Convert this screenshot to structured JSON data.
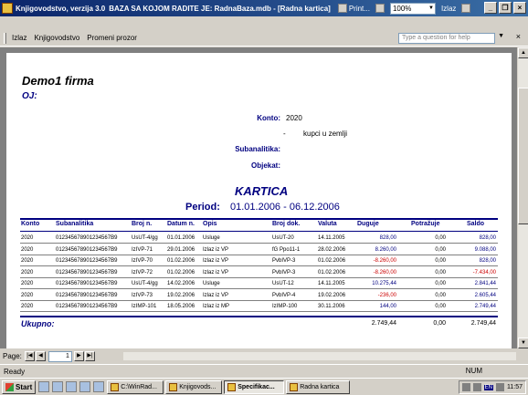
{
  "window": {
    "app_title": "Knjigovodstvo, verzija 3.0",
    "db_info": "BAZA SA KOJOM RADITE JE: RadnaBaza.mdb - [Radna kartica]",
    "print_label": "Print...",
    "zoom": "100%",
    "close_label": "Izlaz"
  },
  "menu": {
    "items": [
      "Izlaz",
      "Knjigovodstvo",
      "Promeni prozor"
    ],
    "question_placeholder": "Type a question for help"
  },
  "report": {
    "company": "Demo1 firma",
    "oj_label": "OJ:",
    "konto_label": "Konto:",
    "konto_value": "2020",
    "dash": "-",
    "konto_name": "kupci u zemlji",
    "subanalitika_label": "Subanalitika:",
    "objekat_label": "Objekat:",
    "title": "KARTICA",
    "period_label": "Period:",
    "period_value": "01.01.2006 - 06.12.2006",
    "columns": [
      "Konto",
      "Subanalitika",
      "Broj n.",
      "Datum n.",
      "Opis",
      "Broj dok.",
      "Valuta",
      "Duguje",
      "Potražuje",
      "Saldo"
    ],
    "rows": [
      [
        "2020",
        "012345678901234567B9",
        "UsUT-4/gg",
        "01.01.2006",
        "Usluge",
        "UsUT-20",
        "14.11.2005",
        "828,00",
        "0,00",
        "828,00"
      ],
      [
        "2020",
        "012345678901234567B9",
        "IzIVP-71",
        "29.01.2006",
        "Izlaz iz VP",
        "fG Ppo11-1",
        "28.02.2006",
        "8.260,00",
        "0,00",
        "9.088,00"
      ],
      [
        "2020",
        "012345678901234567B9",
        "IzIVP-70",
        "01.02.2006",
        "Izlaz iz VP",
        "PvbIVP-3",
        "01.02.2006",
        "-8.260,00",
        "0,00",
        "828,00"
      ],
      [
        "2020",
        "012345678901234567B9",
        "IzIVP-72",
        "01.02.2006",
        "Izlaz iz VP",
        "PvbIVP-3",
        "01.02.2006",
        "-8.260,00",
        "0,00",
        "-7.434,00"
      ],
      [
        "2020",
        "012345678901234567B9",
        "UsUT-4/gg",
        "14.02.2006",
        "Usluge",
        "UsUT-12",
        "14.11.2005",
        "10.275,44",
        "0,00",
        "2.841,44"
      ],
      [
        "2020",
        "012345678901234567B9",
        "IzIVP-73",
        "19.02.2006",
        "Izlaz iz VP",
        "PvbIVP-4",
        "19.02.2006",
        "-236,00",
        "0,00",
        "2.605,44"
      ],
      [
        "2020",
        "012345678901234567B9",
        "IzIMP-101",
        "18.05.2006",
        "Izlaz iz MP",
        "IzIMP-100",
        "30.11.2006",
        "144,00",
        "0,00",
        "2.749,44"
      ]
    ],
    "total_label": "Ukupno:",
    "total_duguje": "2.749,44",
    "total_potrazuje": "0,00",
    "total_saldo": "2.749,44"
  },
  "pager": {
    "label": "Page:",
    "page": "1"
  },
  "status": {
    "left": "Ready",
    "num": "NUM"
  },
  "taskbar": {
    "start": "Start",
    "buttons": [
      "C:\\WinRad...",
      "Knjigovods...",
      "Specifikac...",
      "Radna kartica"
    ],
    "lang": "EN",
    "clock": "11:57"
  },
  "colors": {
    "report_blue": "#000080",
    "negative_red": "#cc0000",
    "titlebar": "#0a246a"
  }
}
